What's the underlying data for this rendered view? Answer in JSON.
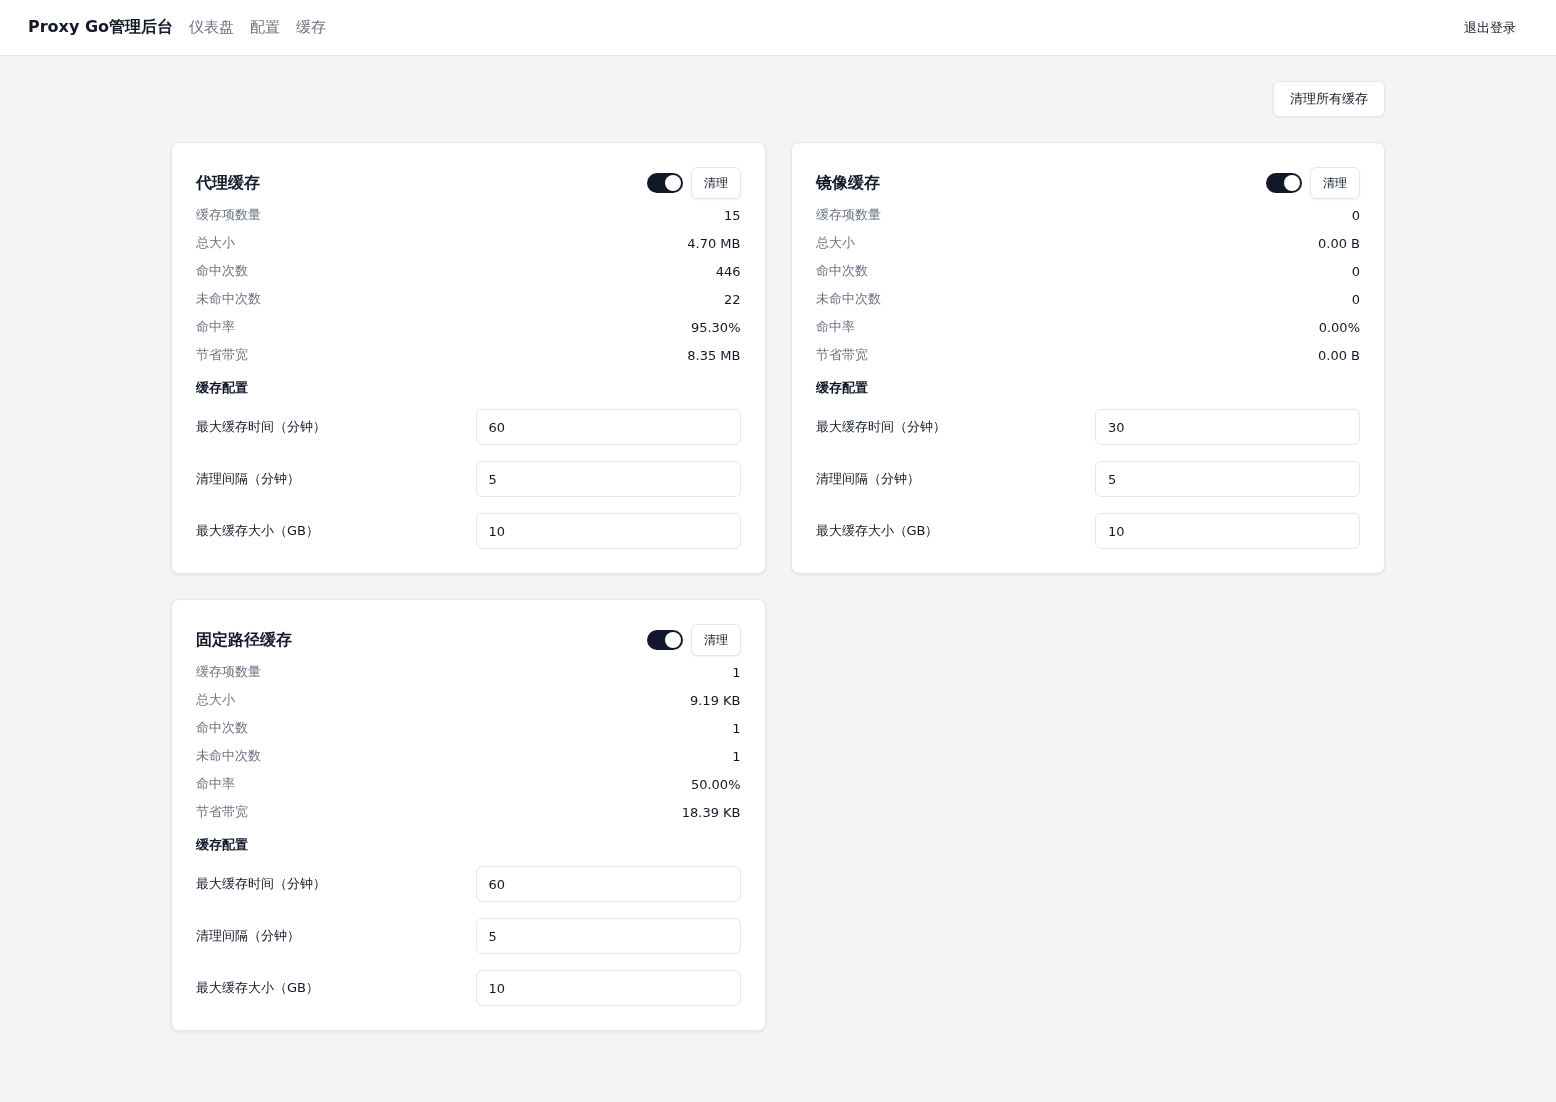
{
  "header": {
    "brand": "Proxy Go管理后台",
    "nav": [
      {
        "label": "仪表盘",
        "selected": false
      },
      {
        "label": "配置",
        "selected": false
      },
      {
        "label": "缓存",
        "selected": false
      }
    ],
    "logout": "退出登录"
  },
  "clear_all_button": "清理所有缓存",
  "caches": [
    {
      "title": "代理缓存",
      "enabled": true,
      "clear_button": "清理",
      "stats": [
        {
          "label": "缓存项数量",
          "value": "15"
        },
        {
          "label": "总大小",
          "value": "4.70 MB"
        },
        {
          "label": "命中次数",
          "value": "446"
        },
        {
          "label": "未命中次数",
          "value": "22"
        },
        {
          "label": "命中率",
          "value": "95.30%"
        },
        {
          "label": "节省带宽",
          "value": "8.35 MB"
        }
      ],
      "config_title": "缓存配置",
      "config": [
        {
          "label": "最大缓存时间（分钟）",
          "value": "60"
        },
        {
          "label": "清理间隔（分钟）",
          "value": "5"
        },
        {
          "label": "最大缓存大小（GB）",
          "value": "10"
        }
      ]
    },
    {
      "title": "镜像缓存",
      "enabled": true,
      "clear_button": "清理",
      "stats": [
        {
          "label": "缓存项数量",
          "value": "0"
        },
        {
          "label": "总大小",
          "value": "0.00 B"
        },
        {
          "label": "命中次数",
          "value": "0"
        },
        {
          "label": "未命中次数",
          "value": "0"
        },
        {
          "label": "命中率",
          "value": "0.00%"
        },
        {
          "label": "节省带宽",
          "value": "0.00 B"
        }
      ],
      "config_title": "缓存配置",
      "config": [
        {
          "label": "最大缓存时间（分钟）",
          "value": "30"
        },
        {
          "label": "清理间隔（分钟）",
          "value": "5"
        },
        {
          "label": "最大缓存大小（GB）",
          "value": "10"
        }
      ]
    },
    {
      "title": "固定路径缓存",
      "enabled": true,
      "clear_button": "清理",
      "stats": [
        {
          "label": "缓存项数量",
          "value": "1"
        },
        {
          "label": "总大小",
          "value": "9.19 KB"
        },
        {
          "label": "命中次数",
          "value": "1"
        },
        {
          "label": "未命中次数",
          "value": "1"
        },
        {
          "label": "命中率",
          "value": "50.00%"
        },
        {
          "label": "节省带宽",
          "value": "18.39 KB"
        }
      ],
      "config_title": "缓存配置",
      "config": [
        {
          "label": "最大缓存时间（分钟）",
          "value": "60"
        },
        {
          "label": "清理间隔（分钟）",
          "value": "5"
        },
        {
          "label": "最大缓存大小（GB）",
          "value": "10"
        }
      ]
    }
  ]
}
